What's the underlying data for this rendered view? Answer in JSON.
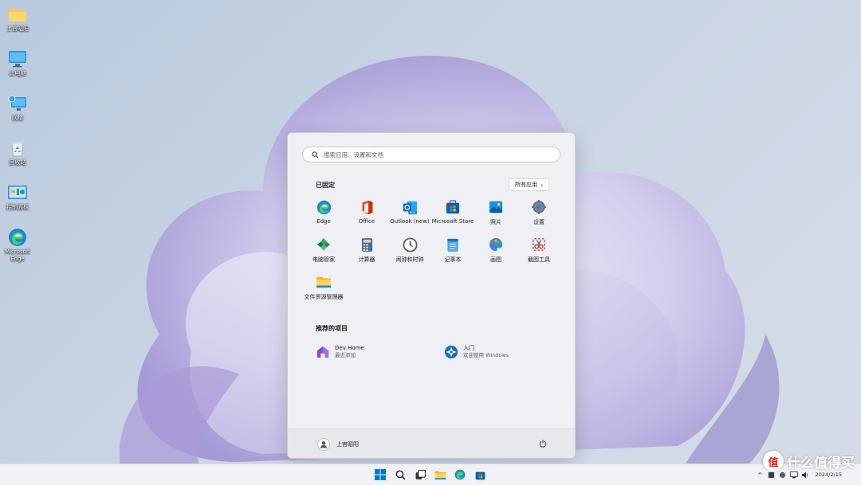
{
  "desktop": {
    "icons": [
      {
        "label": "上官昭阳",
        "icon": "folder-icon"
      },
      {
        "label": "此电脑",
        "icon": "this-pc-icon"
      },
      {
        "label": "网络",
        "icon": "network-icon"
      },
      {
        "label": "回收站",
        "icon": "recycle-bin-icon"
      },
      {
        "label": "控制面板",
        "icon": "control-panel-icon"
      },
      {
        "label": "Microsoft Edge",
        "icon": "edge-icon"
      }
    ]
  },
  "start_menu": {
    "search_placeholder": "搜索应用、设置和文档",
    "pinned_title": "已固定",
    "all_apps_label": "所有应用",
    "pinned": [
      {
        "label": "Edge",
        "icon": "edge-icon"
      },
      {
        "label": "Office",
        "icon": "office-icon"
      },
      {
        "label": "Outlook (new)",
        "icon": "outlook-icon"
      },
      {
        "label": "Microsoft Store",
        "icon": "store-icon"
      },
      {
        "label": "照片",
        "icon": "photos-icon"
      },
      {
        "label": "设置",
        "icon": "settings-icon"
      },
      {
        "label": "电脑管家",
        "icon": "pc-manager-icon"
      },
      {
        "label": "计算器",
        "icon": "calculator-icon"
      },
      {
        "label": "闹钟和时钟",
        "icon": "clock-icon"
      },
      {
        "label": "记事本",
        "icon": "notepad-icon"
      },
      {
        "label": "画图",
        "icon": "paint-icon"
      },
      {
        "label": "截图工具",
        "icon": "snipping-tool-icon"
      },
      {
        "label": "文件资源管理器",
        "icon": "file-explorer-icon"
      }
    ],
    "recommended_title": "推荐的项目",
    "recommended": [
      {
        "title": "Dev Home",
        "subtitle": "最近添加",
        "icon": "dev-home-icon"
      },
      {
        "title": "入门",
        "subtitle": "欢迎使用 Windows",
        "icon": "get-started-icon"
      }
    ],
    "user_name": "上官昭阳"
  },
  "taskbar": {
    "apps": [
      "start-icon",
      "search-icon",
      "task-view-icon",
      "file-explorer-icon",
      "edge-icon",
      "store-icon"
    ],
    "clock_time": "",
    "clock_date": "2024/2/15"
  },
  "watermark": {
    "text": "什么值得买",
    "badge": "值"
  },
  "colors": {
    "accent": "#0078d4",
    "start_bg": "#eef0f4",
    "taskbar_bg": "#f0f2f6"
  }
}
